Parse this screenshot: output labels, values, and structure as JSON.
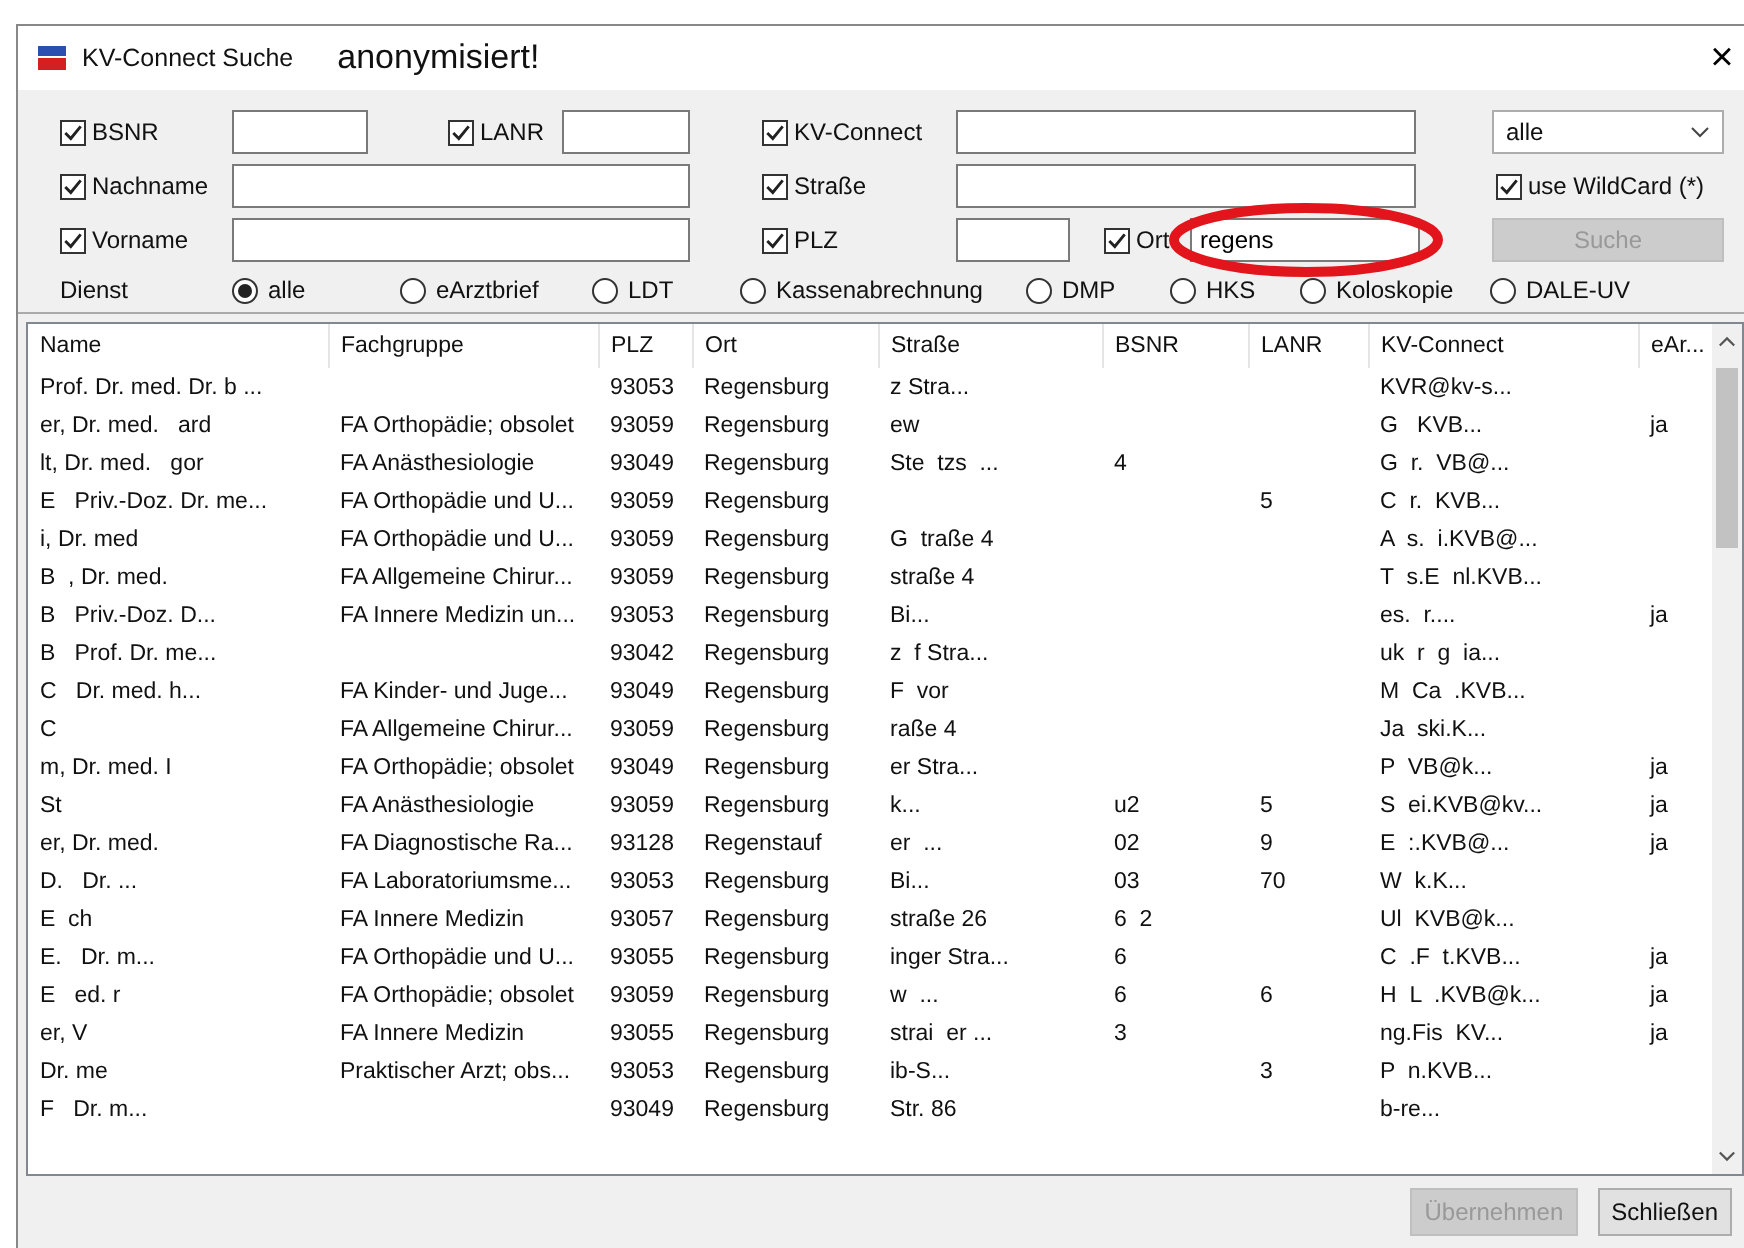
{
  "window": {
    "title": "KV-Connect Suche",
    "annotation": "anonymisiert!",
    "close": "×"
  },
  "fields": {
    "bsnr": {
      "label": "BSNR",
      "checked": true
    },
    "lanr": {
      "label": "LANR",
      "checked": true
    },
    "kv": {
      "label": "KV-Connect",
      "checked": true
    },
    "nachname": {
      "label": "Nachname",
      "checked": true
    },
    "strasse": {
      "label": "Straße",
      "checked": true
    },
    "vorname": {
      "label": "Vorname",
      "checked": true
    },
    "plz": {
      "label": "PLZ",
      "checked": true
    },
    "ort": {
      "label": "Ort",
      "checked": true,
      "value": "regens"
    }
  },
  "scope_select": {
    "value": "alle"
  },
  "wildcard": {
    "label": "use WildCard (*)",
    "checked": true
  },
  "search_button": {
    "label": "Suche",
    "disabled": true
  },
  "service": {
    "label": "Dienst",
    "options": [
      {
        "label": "alle",
        "selected": true
      },
      {
        "label": "eArztbrief",
        "selected": false
      },
      {
        "label": "LDT",
        "selected": false
      },
      {
        "label": "Kassenabrechnung",
        "selected": false
      },
      {
        "label": "DMP",
        "selected": false
      },
      {
        "label": "HKS",
        "selected": false
      },
      {
        "label": "Koloskopie",
        "selected": false
      },
      {
        "label": "DALE-UV",
        "selected": false
      }
    ]
  },
  "table": {
    "columns": [
      "Name",
      "Fachgruppe",
      "PLZ",
      "Ort",
      "Straße",
      "BSNR",
      "LANR",
      "KV-Connect",
      "eAr..."
    ],
    "rows": [
      [
        "Prof. Dr. med. Dr. b ...",
        null,
        "93053",
        "Regensburg",
        "z Stra...",
        null,
        null,
        "KVR@kv-s...",
        null
      ],
      [
        "er, Dr. med.   ard",
        "FA Orthopädie; obsolet",
        "93059",
        "Regensburg",
        "ew",
        null,
        null,
        "G   KVB...",
        "ja"
      ],
      [
        "lt, Dr. med.   gor",
        "FA Anästhesiologie",
        "93049",
        "Regensburg",
        "Ste  tzs  ...",
        "4",
        null,
        "G  r.  VB@...",
        null
      ],
      [
        "E   Priv.-Doz. Dr. me...",
        "FA Orthopädie und U...",
        "93059",
        "Regensburg",
        null,
        null,
        "5",
        "C  r.  KVB...",
        null
      ],
      [
        "i, Dr. med",
        "FA Orthopädie und U...",
        "93059",
        "Regensburg",
        "G  traße 4",
        null,
        null,
        "A  s.  i.KVB@...",
        null
      ],
      [
        "B  , Dr. med.",
        "FA Allgemeine Chirur...",
        "93059",
        "Regensburg",
        "straße 4",
        null,
        null,
        "T  s.E  nl.KVB...",
        null
      ],
      [
        "B   Priv.-Doz. D...",
        "FA Innere Medizin un...",
        "93053",
        "Regensburg",
        "Bi...",
        null,
        null,
        "es.  r....",
        "ja"
      ],
      [
        "B   Prof. Dr. me...",
        null,
        "93042",
        "Regensburg",
        "z  f Stra...",
        null,
        null,
        "uk  r  g  ia...",
        null
      ],
      [
        "C   Dr. med. h...",
        "FA Kinder- und Juge...",
        "93049",
        "Regensburg",
        "F  vor",
        null,
        null,
        "M  Ca  .KVB...",
        null
      ],
      [
        "C",
        "FA Allgemeine Chirur...",
        "93059",
        "Regensburg",
        "raße 4",
        null,
        null,
        "Ja  ski.K...",
        null
      ],
      [
        "m, Dr. med. I",
        "FA Orthopädie; obsolet",
        "93049",
        "Regensburg",
        "er Stra...",
        null,
        null,
        "P  VB@k...",
        "ja"
      ],
      [
        "St",
        "FA Anästhesiologie",
        "93059",
        "Regensburg",
        "k...",
        "u2",
        "5",
        "S  ei.KVB@kv...",
        "ja"
      ],
      [
        "er, Dr. med.",
        "FA Diagnostische Ra...",
        "93128",
        "Regenstauf",
        "er  ...",
        "02",
        "9",
        "E  :.KVB@...",
        "ja"
      ],
      [
        "D.   Dr. ...",
        "FA Laboratoriumsme...",
        "93053",
        "Regensburg",
        "Bi...",
        "03",
        "70",
        "W  k.K...",
        null
      ],
      [
        "E  ch",
        "FA Innere Medizin",
        "93057",
        "Regensburg",
        "straße 26",
        "6  2",
        null,
        "Ul  KVB@k...",
        null
      ],
      [
        "E.   Dr. m...",
        "FA Orthopädie und U...",
        "93055",
        "Regensburg",
        "inger Stra...",
        "6",
        null,
        "C  .F  t.KVB...",
        "ja"
      ],
      [
        "E   ed. r",
        "FA Orthopädie; obsolet",
        "93059",
        "Regensburg",
        "w  ...",
        "6",
        "6",
        "H  L  .KVB@k...",
        "ja"
      ],
      [
        "er, V",
        "FA Innere Medizin",
        "93055",
        "Regensburg",
        "strai  er ...",
        "3",
        null,
        "ng.Fis  KV...",
        "ja"
      ],
      [
        "Dr. me",
        "Praktischer Arzt; obs...",
        "93053",
        "Regensburg",
        "ib-S...",
        null,
        "3",
        "P  n.KVB...",
        null
      ],
      [
        "F   Dr. m...",
        null,
        "93049",
        "Regensburg",
        "Str. 86",
        null,
        null,
        "b-re...",
        null
      ]
    ]
  },
  "buttons": [
    {
      "label": "Übernehmen",
      "disabled": true
    },
    {
      "label": "Schließen",
      "disabled": false
    }
  ]
}
